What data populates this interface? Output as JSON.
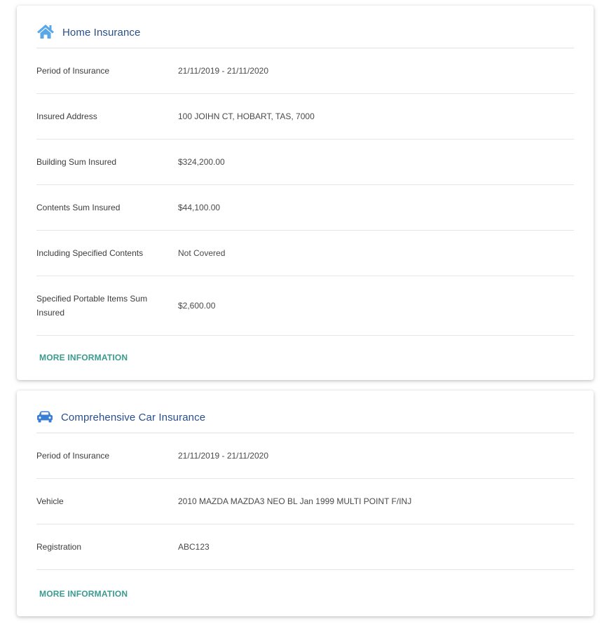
{
  "home": {
    "title": "Home Insurance",
    "icon": "house-icon",
    "accent": "#5aa7e8",
    "rows": [
      {
        "label": "Period of Insurance",
        "value": "21/11/2019 - 21/11/2020"
      },
      {
        "label": "Insured Address",
        "value": "100 JOIHN CT, HOBART, TAS, 7000"
      },
      {
        "label": "Building Sum Insured",
        "value": "$324,200.00"
      },
      {
        "label": "Contents Sum Insured",
        "value": "$44,100.00"
      },
      {
        "label": "Including Specified Contents",
        "value": "Not Covered"
      },
      {
        "label": "Specified Portable Items Sum Insured",
        "value": "$2,600.00"
      }
    ],
    "more_label": "MORE INFORMATION"
  },
  "car": {
    "title": "Comprehensive Car Insurance",
    "icon": "car-icon",
    "accent": "#3b7fd4",
    "rows": [
      {
        "label": "Period of Insurance",
        "value": "21/11/2019 - 21/11/2020"
      },
      {
        "label": "Vehicle",
        "value": "2010 MAZDA MAZDA3 NEO BL Jan 1999 MULTI POINT F/INJ"
      },
      {
        "label": "Registration",
        "value": "ABC123"
      }
    ],
    "more_label": "MORE INFORMATION"
  },
  "colors": {
    "title": "#2a4f8c",
    "link": "#3a9a8e",
    "divider": "#e6e6e6"
  }
}
